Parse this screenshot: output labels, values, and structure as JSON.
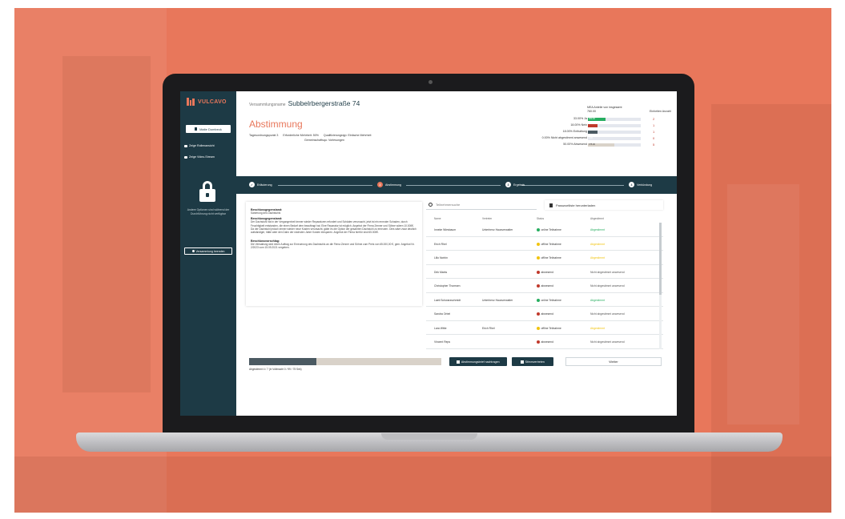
{
  "colors": {
    "backdrop": "#e8775b",
    "sidebar": "#1d3a45",
    "accent": "#e8775b",
    "online": "#27ae60",
    "offline": "#f1c40f",
    "absent": "#c0392b"
  },
  "sidebar": {
    "logo_text": "VULCAVO",
    "user_button": "Malte Dombeck",
    "links": [
      "Zeige Rollenansicht",
      "Zeige Video-Stream"
    ],
    "lock_text": "Andere Optionen sind während der Durchführung nicht verfügbar",
    "end_button": "Versammlung beenden"
  },
  "header": {
    "assembly_label": "Versammlungsname",
    "assembly_name": "Subbelrbergerstraße 74",
    "title": "Abstimmung",
    "agenda_item": "Tagesordnungspunkt 3",
    "required_majority": "Erforderliche Mehrheit: 50%",
    "qualification": "Qualifizierungstyp: Einfache Mehrheit",
    "community": "Gemeinschaftsqu: Vorlesungen"
  },
  "stats": {
    "mea_label": "MEA Anteile von insgesamt",
    "mea_total": "760.00",
    "individual_label": "Einheiten Anzahl",
    "rows": [
      {
        "label": "33.00% Ja",
        "fill": 0.33,
        "fill_text": "250.00",
        "color": "#27ae60",
        "count": "2"
      },
      {
        "label": "18.00% Nein",
        "fill": 0.18,
        "fill_text": "",
        "color": "#c0392b",
        "count": "1"
      },
      {
        "label": "18.00% Enthaltung",
        "fill": 0.18,
        "fill_text": "",
        "color": "#4b5a62",
        "count": "1"
      },
      {
        "label": "0.00% Nicht abgestimmt anwesend",
        "fill": 0.0,
        "fill_text": "0.00",
        "color": "#f1c40f",
        "count": "0"
      },
      {
        "label": "50.00% Abwesend",
        "fill": 0.5,
        "fill_text": "375.00",
        "color": "#d9d2c9",
        "count": "5"
      }
    ]
  },
  "stepper": {
    "steps": [
      {
        "label": "Erläuterung",
        "num": "✓",
        "active": false
      },
      {
        "label": "Abstimmung",
        "num": "2",
        "active": true
      },
      {
        "label": "Ergebnis",
        "num": "3",
        "active": false
      },
      {
        "label": "Verkündung",
        "num": "4",
        "active": false
      }
    ]
  },
  "description": {
    "h1": "Beschlussgegenstand:",
    "p1": "Sanierung des Dachstuhls",
    "h2": "Beschlussgegenstand:",
    "p2": "Der Dachstuhl hat in der Vergangenheit immer wieder Reparaturen erfordert und Schäden verursacht, jetzt ist ein erneuter Schaden, durch Feuchtigkeit entstanden, die einen Bedarf dem beauftragt hat. Eine Reparatur ist möglich. Angebot der Firma Zenner und Söhne wären 10.000€. Da der Dachstuhl jedoch immer wieder neue Kosten verursacht, gäbe es die Option der gesamten Dachstuhl zu erneuern. Dies wäre zwar deutlich aufwändiger, hätte aber den Dahn der nächsten Jahre Kosten einsparen. Angebot der Firma hierfür sind 65.000€.",
    "h3": "Beschlussvorschlag:",
    "p3": "Die Verwaltung wird einen Auftrag zur Erneuerung des Dachstuhls an die Firma Zenner und Söhne zum Preis von 65.000,00 €, gem. Angebot Nr. 2/2023 vom 15.09.2021 vergeben."
  },
  "participants": {
    "search_placeholder": "Teilnehmersuche",
    "pw_button": "Passwortliste herunterladen",
    "columns": [
      "Name",
      "Vertreter",
      "Status",
      "Abgestimmt"
    ],
    "rows": [
      {
        "name": "Inneke Wiesbaum",
        "rep": "Unterhenz Hausverwalter",
        "status": "online Teilnahme",
        "status_color": "#27ae60",
        "vote": "Abgestimmt",
        "vote_color": "#27ae60"
      },
      {
        "name": "Erich Rhel",
        "rep": "",
        "status": "offline Teilnahme",
        "status_color": "#f1c40f",
        "vote": "Abgestimmt",
        "vote_color": "#f1c40f"
      },
      {
        "name": "Lillo Norbin",
        "rep": "",
        "status": "offline Teilnahme",
        "status_color": "#f1c40f",
        "vote": "Abgestimmt",
        "vote_color": "#f1c40f"
      },
      {
        "name": "Dirk Marks",
        "rep": "",
        "status": "abwesend",
        "status_color": "#c0392b",
        "vote": "Nicht abgestimmt anwesend",
        "vote_color": "#555555"
      },
      {
        "name": "Christopher Thomsen",
        "rep": "",
        "status": "abwesend",
        "status_color": "#c0392b",
        "vote": "Nicht abgestimmt anwesend",
        "vote_color": "#555555"
      },
      {
        "name": "Laeti Schwarzschmidt",
        "rep": "Unterhenz Hausverwalter",
        "status": "online Teilnahme",
        "status_color": "#27ae60",
        "vote": "Abgestimmt",
        "vote_color": "#27ae60"
      },
      {
        "name": "Sandra Orbel",
        "rep": "",
        "status": "abwesend",
        "status_color": "#c0392b",
        "vote": "Nicht abgestimmt anwesend",
        "vote_color": "#555555"
      },
      {
        "name": "Lara Witte",
        "rep": "Erich Rhel",
        "status": "offline Teilnahme",
        "status_color": "#f1c40f",
        "vote": "Abgestimmt",
        "vote_color": "#f1c40f"
      },
      {
        "name": "Vincent Reps",
        "rep": "",
        "status": "abwesend",
        "status_color": "#c0392b",
        "vote": "Nicht abgestimmt anwesend",
        "vote_color": "#555555"
      }
    ]
  },
  "footer": {
    "progress": 0.35,
    "progress_text": "Abgestimmt 4 / 7 (in Vollmacht 0 / 99 / 75 Sek)",
    "reminder_button": "Abstimmungsbrief nachtragen",
    "proxy_button": "Stimmvertreten",
    "next_button": "Weiter"
  }
}
